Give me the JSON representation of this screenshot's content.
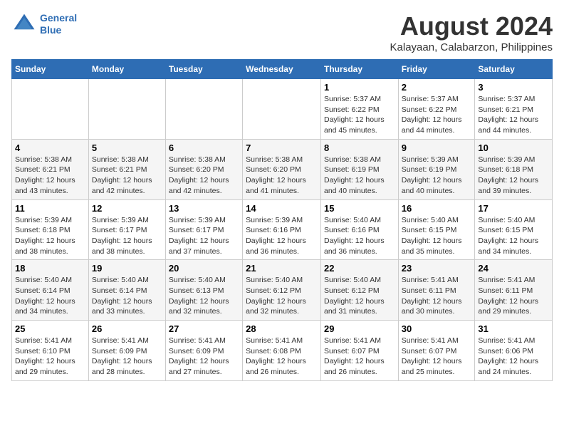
{
  "header": {
    "logo_line1": "General",
    "logo_line2": "Blue",
    "title": "August 2024",
    "subtitle": "Kalayaan, Calabarzon, Philippines"
  },
  "days_of_week": [
    "Sunday",
    "Monday",
    "Tuesday",
    "Wednesday",
    "Thursday",
    "Friday",
    "Saturday"
  ],
  "weeks": [
    [
      {
        "day": "",
        "info": ""
      },
      {
        "day": "",
        "info": ""
      },
      {
        "day": "",
        "info": ""
      },
      {
        "day": "",
        "info": ""
      },
      {
        "day": "1",
        "info": "Sunrise: 5:37 AM\nSunset: 6:22 PM\nDaylight: 12 hours\nand 45 minutes."
      },
      {
        "day": "2",
        "info": "Sunrise: 5:37 AM\nSunset: 6:22 PM\nDaylight: 12 hours\nand 44 minutes."
      },
      {
        "day": "3",
        "info": "Sunrise: 5:37 AM\nSunset: 6:21 PM\nDaylight: 12 hours\nand 44 minutes."
      }
    ],
    [
      {
        "day": "4",
        "info": "Sunrise: 5:38 AM\nSunset: 6:21 PM\nDaylight: 12 hours\nand 43 minutes."
      },
      {
        "day": "5",
        "info": "Sunrise: 5:38 AM\nSunset: 6:21 PM\nDaylight: 12 hours\nand 42 minutes."
      },
      {
        "day": "6",
        "info": "Sunrise: 5:38 AM\nSunset: 6:20 PM\nDaylight: 12 hours\nand 42 minutes."
      },
      {
        "day": "7",
        "info": "Sunrise: 5:38 AM\nSunset: 6:20 PM\nDaylight: 12 hours\nand 41 minutes."
      },
      {
        "day": "8",
        "info": "Sunrise: 5:38 AM\nSunset: 6:19 PM\nDaylight: 12 hours\nand 40 minutes."
      },
      {
        "day": "9",
        "info": "Sunrise: 5:39 AM\nSunset: 6:19 PM\nDaylight: 12 hours\nand 40 minutes."
      },
      {
        "day": "10",
        "info": "Sunrise: 5:39 AM\nSunset: 6:18 PM\nDaylight: 12 hours\nand 39 minutes."
      }
    ],
    [
      {
        "day": "11",
        "info": "Sunrise: 5:39 AM\nSunset: 6:18 PM\nDaylight: 12 hours\nand 38 minutes."
      },
      {
        "day": "12",
        "info": "Sunrise: 5:39 AM\nSunset: 6:17 PM\nDaylight: 12 hours\nand 38 minutes."
      },
      {
        "day": "13",
        "info": "Sunrise: 5:39 AM\nSunset: 6:17 PM\nDaylight: 12 hours\nand 37 minutes."
      },
      {
        "day": "14",
        "info": "Sunrise: 5:39 AM\nSunset: 6:16 PM\nDaylight: 12 hours\nand 36 minutes."
      },
      {
        "day": "15",
        "info": "Sunrise: 5:40 AM\nSunset: 6:16 PM\nDaylight: 12 hours\nand 36 minutes."
      },
      {
        "day": "16",
        "info": "Sunrise: 5:40 AM\nSunset: 6:15 PM\nDaylight: 12 hours\nand 35 minutes."
      },
      {
        "day": "17",
        "info": "Sunrise: 5:40 AM\nSunset: 6:15 PM\nDaylight: 12 hours\nand 34 minutes."
      }
    ],
    [
      {
        "day": "18",
        "info": "Sunrise: 5:40 AM\nSunset: 6:14 PM\nDaylight: 12 hours\nand 34 minutes."
      },
      {
        "day": "19",
        "info": "Sunrise: 5:40 AM\nSunset: 6:14 PM\nDaylight: 12 hours\nand 33 minutes."
      },
      {
        "day": "20",
        "info": "Sunrise: 5:40 AM\nSunset: 6:13 PM\nDaylight: 12 hours\nand 32 minutes."
      },
      {
        "day": "21",
        "info": "Sunrise: 5:40 AM\nSunset: 6:12 PM\nDaylight: 12 hours\nand 32 minutes."
      },
      {
        "day": "22",
        "info": "Sunrise: 5:40 AM\nSunset: 6:12 PM\nDaylight: 12 hours\nand 31 minutes."
      },
      {
        "day": "23",
        "info": "Sunrise: 5:41 AM\nSunset: 6:11 PM\nDaylight: 12 hours\nand 30 minutes."
      },
      {
        "day": "24",
        "info": "Sunrise: 5:41 AM\nSunset: 6:11 PM\nDaylight: 12 hours\nand 29 minutes."
      }
    ],
    [
      {
        "day": "25",
        "info": "Sunrise: 5:41 AM\nSunset: 6:10 PM\nDaylight: 12 hours\nand 29 minutes."
      },
      {
        "day": "26",
        "info": "Sunrise: 5:41 AM\nSunset: 6:09 PM\nDaylight: 12 hours\nand 28 minutes."
      },
      {
        "day": "27",
        "info": "Sunrise: 5:41 AM\nSunset: 6:09 PM\nDaylight: 12 hours\nand 27 minutes."
      },
      {
        "day": "28",
        "info": "Sunrise: 5:41 AM\nSunset: 6:08 PM\nDaylight: 12 hours\nand 26 minutes."
      },
      {
        "day": "29",
        "info": "Sunrise: 5:41 AM\nSunset: 6:07 PM\nDaylight: 12 hours\nand 26 minutes."
      },
      {
        "day": "30",
        "info": "Sunrise: 5:41 AM\nSunset: 6:07 PM\nDaylight: 12 hours\nand 25 minutes."
      },
      {
        "day": "31",
        "info": "Sunrise: 5:41 AM\nSunset: 6:06 PM\nDaylight: 12 hours\nand 24 minutes."
      }
    ]
  ]
}
